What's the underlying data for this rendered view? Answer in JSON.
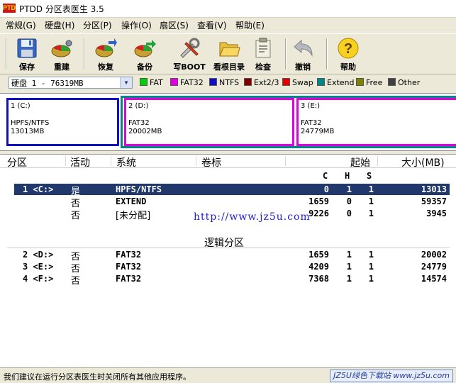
{
  "window": {
    "title": "PTDD 分区表医生 3.5",
    "icon_text": "PTD"
  },
  "menu": [
    "常规(G)",
    "硬盘(H)",
    "分区(P)",
    "操作(O)",
    "扇区(S)",
    "查看(V)",
    "帮助(E)"
  ],
  "toolbar": {
    "save": "保存",
    "rebuild": "重建",
    "restore": "恢复",
    "backup": "备份",
    "write_boot": "写BOOT",
    "view_root": "看根目录",
    "check": "检查",
    "undo": "撤销",
    "help": "帮助"
  },
  "drive_select": {
    "value": "硬盘 1 - 76319MB"
  },
  "legend": [
    {
      "label": "FAT",
      "color": "#00d000"
    },
    {
      "label": "FAT32",
      "color": "#e000e0"
    },
    {
      "label": "NTFS",
      "color": "#1010c0"
    },
    {
      "label": "Ext2/3",
      "color": "#800000"
    },
    {
      "label": "Swap",
      "color": "#e00000"
    },
    {
      "label": "Extend",
      "color": "#008888"
    },
    {
      "label": "Free",
      "color": "#808000"
    },
    {
      "label": "Other",
      "color": "#404040"
    }
  ],
  "partition_map": [
    {
      "id": "1 (C:)",
      "fs": "HPFS/NTFS",
      "size": "13013MB",
      "border": "#1010c0"
    },
    {
      "id": "2 (D:)",
      "fs": "FAT32",
      "size": "20002MB",
      "border": "#e000e0"
    },
    {
      "id": "3 (E:)",
      "fs": "FAT32",
      "size": "24779MB",
      "border": "#e000e0"
    }
  ],
  "columns": {
    "partition": "分区",
    "active": "活动",
    "system": "系统",
    "label": "卷标",
    "start": "起始",
    "size": "大小(MB)",
    "c": "C",
    "h": "H",
    "s": "S"
  },
  "primary_rows": [
    {
      "part": "1 <C:>",
      "active": "是",
      "system": "HPFS/NTFS",
      "c": "0",
      "h": "1",
      "s": "1",
      "size": "13013"
    },
    {
      "part": "",
      "active": "否",
      "system": "EXTEND",
      "c": "1659",
      "h": "0",
      "s": "1",
      "size": "59357"
    },
    {
      "part": "",
      "active": "否",
      "system": "[未分配]",
      "c": "9226",
      "h": "0",
      "s": "1",
      "size": "3945"
    }
  ],
  "watermark": "http://www.jz5u.com",
  "logical_title": "逻辑分区",
  "logical_rows": [
    {
      "part": "2 <D:>",
      "active": "否",
      "system": "FAT32",
      "c": "1659",
      "h": "1",
      "s": "1",
      "size": "20002"
    },
    {
      "part": "3 <E:>",
      "active": "否",
      "system": "FAT32",
      "c": "4209",
      "h": "1",
      "s": "1",
      "size": "24779"
    },
    {
      "part": "4 <F:>",
      "active": "否",
      "system": "FAT32",
      "c": "7368",
      "h": "1",
      "s": "1",
      "size": "14574"
    }
  ],
  "status": {
    "message": "我们建议在运行分区表医生时关闭所有其他应用程序。",
    "brand": "JZ5U绿色下载站 www.jz5u.com"
  }
}
